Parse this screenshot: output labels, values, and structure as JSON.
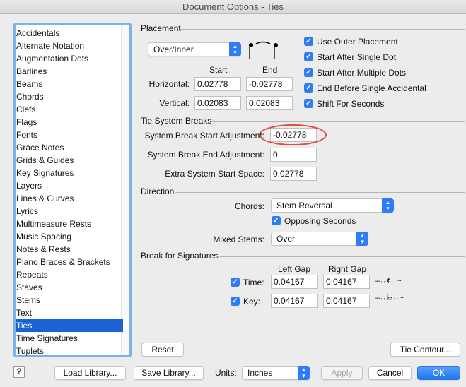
{
  "window": {
    "title": "Document Options - Ties"
  },
  "sidebar": {
    "items": [
      "Accidentals",
      "Alternate Notation",
      "Augmentation Dots",
      "Barlines",
      "Beams",
      "Chords",
      "Clefs",
      "Flags",
      "Fonts",
      "Grace Notes",
      "Grids & Guides",
      "Key Signatures",
      "Layers",
      "Lines & Curves",
      "Lyrics",
      "Multimeasure Rests",
      "Music Spacing",
      "Notes & Rests",
      "Piano Braces & Brackets",
      "Repeats",
      "Staves",
      "Stems",
      "Text",
      "Ties",
      "Time Signatures",
      "Tuplets"
    ],
    "selected": "Ties"
  },
  "placement": {
    "title": "Placement",
    "popup": "Over/Inner",
    "start_header": "Start",
    "end_header": "End",
    "horizontal_label": "Horizontal:",
    "vertical_label": "Vertical:",
    "h_start": "0.02778",
    "h_end": "-0.02778",
    "v_start": "0.02083",
    "v_end": "0.02083",
    "checks": [
      {
        "label": "Use Outer Placement",
        "checked": true
      },
      {
        "label": "Start After Single Dot",
        "checked": true
      },
      {
        "label": "Start After Multiple Dots",
        "checked": true
      },
      {
        "label": "End Before Single Accidental",
        "checked": true
      },
      {
        "label": "Shift For Seconds",
        "checked": true
      }
    ]
  },
  "breaks": {
    "title": "Tie System Breaks",
    "start_label": "System Break Start Adjustment:",
    "start_value": "-0.02778",
    "end_label": "System Break End Adjustment:",
    "end_value": "0",
    "extra_label": "Extra System Start Space:",
    "extra_value": "0.02778"
  },
  "direction": {
    "title": "Direction",
    "chords_label": "Chords:",
    "chords_value": "Stem Reversal",
    "opposing_label": "Opposing Seconds",
    "opposing_checked": true,
    "mixed_label": "Mixed Stems:",
    "mixed_value": "Over"
  },
  "signatures": {
    "title": "Break for Signatures",
    "left_header": "Left Gap",
    "right_header": "Right Gap",
    "time_label": "Time:",
    "time_left": "0.04167",
    "time_right": "0.04167",
    "key_label": "Key:",
    "key_left": "0.04167",
    "key_right": "0.04167",
    "time_checked": true,
    "key_checked": true
  },
  "buttons": {
    "reset": "Reset",
    "tie_contour": "Tie Contour...",
    "help": "?",
    "load": "Load Library...",
    "save": "Save Library...",
    "units_label": "Units:",
    "units_value": "Inches",
    "apply": "Apply",
    "cancel": "Cancel",
    "ok": "OK"
  },
  "colors": {
    "accent": "#2f7cf6",
    "selection": "#1b62d4",
    "highlight_circle": "#e04a3e"
  }
}
